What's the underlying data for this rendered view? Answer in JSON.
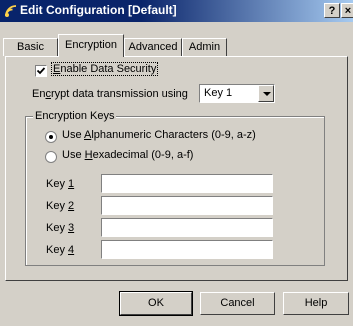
{
  "window": {
    "title": "Edit Configuration [Default]",
    "help_glyph": "?",
    "close_glyph": "×"
  },
  "tabs": [
    {
      "label": "Basic"
    },
    {
      "label": "Encryption"
    },
    {
      "label": "Advanced"
    },
    {
      "label": "Admin"
    }
  ],
  "encryption": {
    "enable_label_mnemonic": "E",
    "enable_label_rest": "nable Data Security",
    "enable_checked": true,
    "transmission_label_pre": "En",
    "transmission_label_mn": "c",
    "transmission_label_post": "rypt data transmission using",
    "transmission_value": "Key 1",
    "group_title": "Encryption Keys",
    "radio_alpha": {
      "pre": "Use ",
      "mn": "A",
      "post": "lphanumeric Characters (0-9, a-z)",
      "selected": true
    },
    "radio_hex": {
      "pre": "Use ",
      "mn": "H",
      "post": "exadecimal (0-9, a-f)",
      "selected": false
    },
    "keys": [
      {
        "label_pre": "Key ",
        "label_mn": "1",
        "value": ""
      },
      {
        "label_pre": "Key ",
        "label_mn": "2",
        "value": ""
      },
      {
        "label_pre": "Key ",
        "label_mn": "3",
        "value": ""
      },
      {
        "label_pre": "Key ",
        "label_mn": "4",
        "value": ""
      }
    ]
  },
  "buttons": {
    "ok": "OK",
    "cancel": "Cancel",
    "help": "Help"
  },
  "colors": {
    "face": "#d4d0c8",
    "title_start": "#0a246a",
    "title_end": "#a6caf0"
  }
}
